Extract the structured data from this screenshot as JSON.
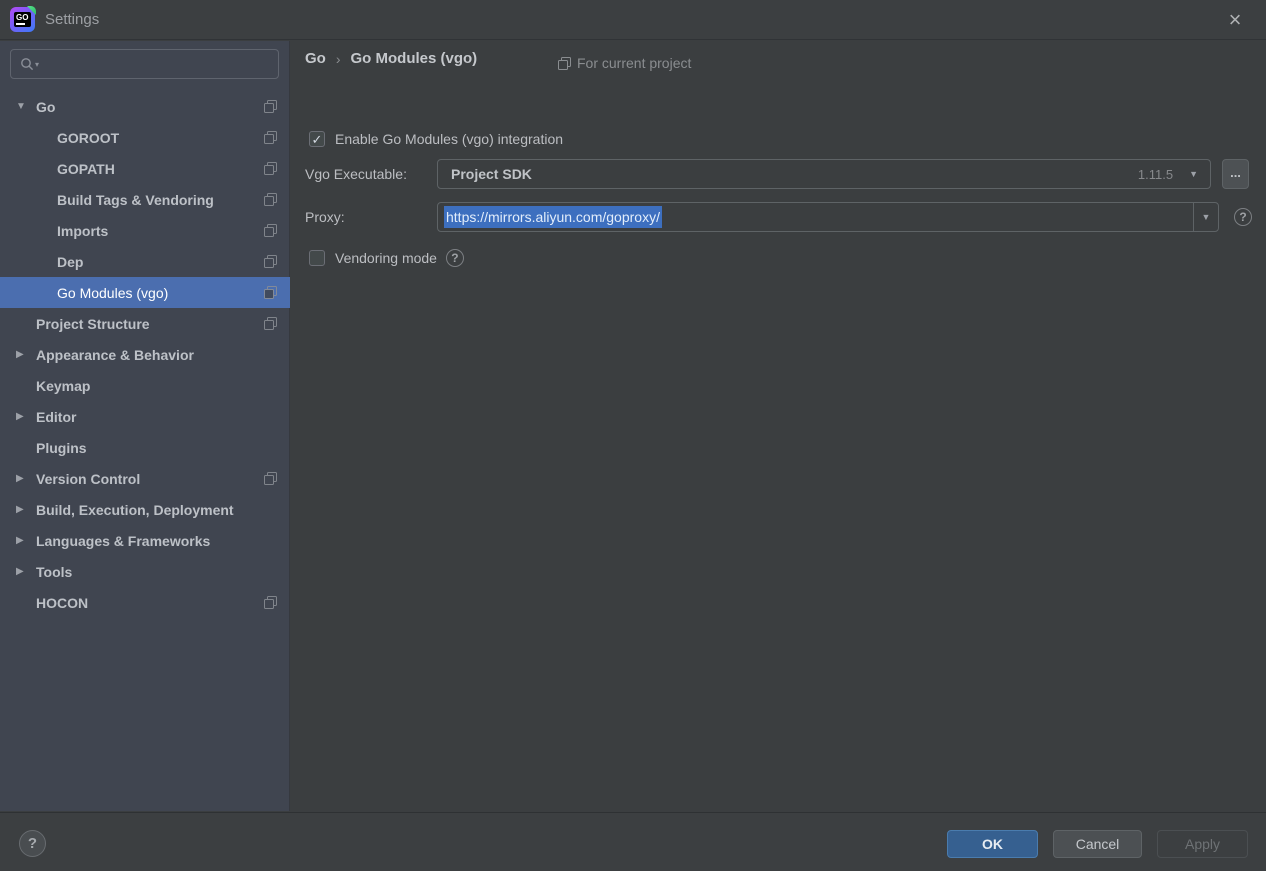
{
  "window": {
    "title": "Settings",
    "logo_text": "GO"
  },
  "icons": {
    "expanded": "▼",
    "collapsed": "▶",
    "check": "✓",
    "dropdown": "▼",
    "search_dropdown": "▾",
    "help": "?",
    "close": "×"
  },
  "search": {
    "placeholder": "",
    "value": ""
  },
  "sidebar": {
    "items": [
      {
        "label": "Go",
        "level": 0,
        "arrow": "expanded",
        "project_icon": true,
        "selected": false
      },
      {
        "label": "GOROOT",
        "level": 1,
        "arrow": "none",
        "project_icon": true,
        "selected": false
      },
      {
        "label": "GOPATH",
        "level": 1,
        "arrow": "none",
        "project_icon": true,
        "selected": false
      },
      {
        "label": "Build Tags & Vendoring",
        "level": 1,
        "arrow": "none",
        "project_icon": true,
        "selected": false
      },
      {
        "label": "Imports",
        "level": 1,
        "arrow": "none",
        "project_icon": true,
        "selected": false
      },
      {
        "label": "Dep",
        "level": 1,
        "arrow": "none",
        "project_icon": true,
        "selected": false
      },
      {
        "label": "Go Modules (vgo)",
        "level": 1,
        "arrow": "none",
        "project_icon": true,
        "selected": true
      },
      {
        "label": "Project Structure",
        "level": 0,
        "arrow": "none",
        "project_icon": true,
        "selected": false
      },
      {
        "label": "Appearance & Behavior",
        "level": 0,
        "arrow": "collapsed",
        "project_icon": false,
        "selected": false
      },
      {
        "label": "Keymap",
        "level": 0,
        "arrow": "none",
        "project_icon": false,
        "selected": false
      },
      {
        "label": "Editor",
        "level": 0,
        "arrow": "collapsed",
        "project_icon": false,
        "selected": false
      },
      {
        "label": "Plugins",
        "level": 0,
        "arrow": "none",
        "project_icon": false,
        "selected": false
      },
      {
        "label": "Version Control",
        "level": 0,
        "arrow": "collapsed",
        "project_icon": true,
        "selected": false
      },
      {
        "label": "Build, Execution, Deployment",
        "level": 0,
        "arrow": "collapsed",
        "project_icon": false,
        "selected": false
      },
      {
        "label": "Languages & Frameworks",
        "level": 0,
        "arrow": "collapsed",
        "project_icon": false,
        "selected": false
      },
      {
        "label": "Tools",
        "level": 0,
        "arrow": "collapsed",
        "project_icon": false,
        "selected": false
      },
      {
        "label": "HOCON",
        "level": 0,
        "arrow": "none",
        "project_icon": true,
        "selected": false
      }
    ]
  },
  "main": {
    "breadcrumb": {
      "parent": "Go",
      "separator": "›",
      "current": "Go Modules (vgo)"
    },
    "scope_note": "For current project",
    "enable_checkbox": {
      "label": "Enable Go Modules (vgo) integration",
      "checked": true
    },
    "vgo_executable": {
      "label": "Vgo Executable:",
      "value": "Project SDK",
      "version": "1.11.5",
      "browse_label": "..."
    },
    "proxy": {
      "label": "Proxy:",
      "value": "https://mirrors.aliyun.com/goproxy/",
      "text_selected": true
    },
    "vendoring": {
      "label": "Vendoring mode",
      "checked": false
    }
  },
  "footer": {
    "ok_label": "OK",
    "cancel_label": "Cancel",
    "apply_label": "Apply",
    "apply_enabled": false
  },
  "colors": {
    "main_bg": "#3B3E40",
    "sidebar_bg": "#404550",
    "titlebar_bg": "#3C3F41",
    "selection_blue": "#4B6EAF",
    "text_selection_bg": "#3D6FBF",
    "ok_bg": "#366090",
    "field_border": "#5E6366"
  }
}
